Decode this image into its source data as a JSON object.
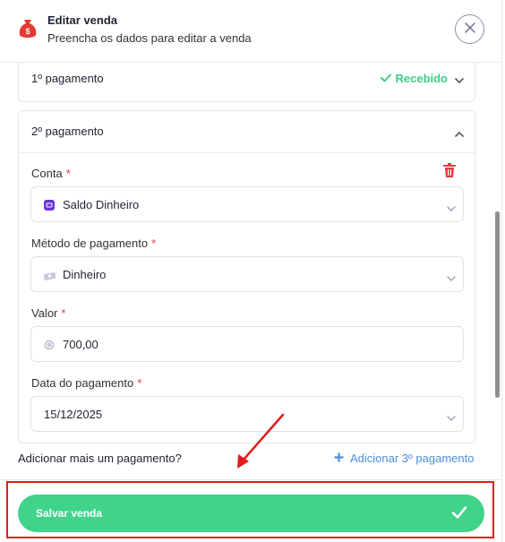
{
  "header": {
    "title": "Editar venda",
    "subtitle": "Preencha os dados para editar a venda"
  },
  "payment1": {
    "title": "1º pagamento",
    "status": "Recebido"
  },
  "payment2": {
    "title": "2º pagamento",
    "account": {
      "label": "Conta",
      "required": "*",
      "value": "Saldo Dinheiro"
    },
    "method": {
      "label": "Método de pagamento",
      "required": "*",
      "value": "Dinheiro"
    },
    "amount": {
      "label": "Valor",
      "required": "*",
      "value": "700,00"
    },
    "date": {
      "label": "Data do pagamento",
      "required": "*",
      "value": "15/12/2025"
    }
  },
  "add_more": {
    "question": "Adicionar mais um pagamento?",
    "link": "Adicionar 3º pagamento"
  },
  "footer": {
    "save_label": "Salvar venda"
  },
  "colors": {
    "accent_green": "#40d38a",
    "received_green": "#3ecf82",
    "link_blue": "#4a90d9",
    "required_red": "#e53945",
    "annotation_red": "#e31b1b"
  }
}
